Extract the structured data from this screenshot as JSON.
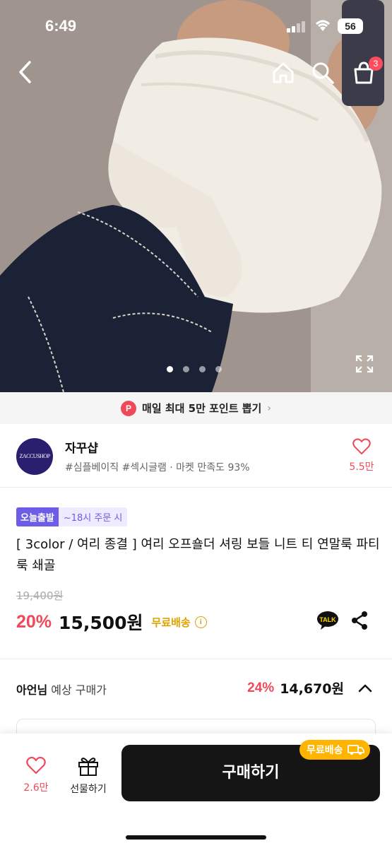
{
  "status_bar": {
    "time": "6:49",
    "battery": "56"
  },
  "header": {
    "back_icon": "chevron-left-icon",
    "home_icon": "home-icon",
    "search_icon": "search-icon",
    "cart_icon": "shopping-bag-icon",
    "cart_count": "3"
  },
  "gallery": {
    "total_images": 4,
    "active_index": 0
  },
  "point_banner": {
    "badge": "P",
    "text": "매일 최대 5만 포인트 뽑기"
  },
  "shop": {
    "logo_text": "ZACCUSHOP",
    "name": "자꾸샵",
    "tags": "#심플베이직 #섹시글램 · 마켓 만족도 93%",
    "like_count": "5.5만"
  },
  "product": {
    "badge_today": "오늘출발",
    "badge_time": "~18시 주문 시",
    "title": "[ 3color / 여리 종결 ] 여리 오프숄더 셔링 보들 니트 티 연말룩 파티룩 쇄골",
    "original_price": "19,400원",
    "discount": "20%",
    "price": "15,500원",
    "free_shipping": "무료배송",
    "talk_label": "TALK"
  },
  "member_price": {
    "name": "아언님",
    "label": "예상 구매가",
    "discount": "24%",
    "price": "14,670원"
  },
  "bottom_bar": {
    "wish_count": "2.6만",
    "gift_label": "선물하기",
    "buy_label": "구매하기",
    "free_tag": "무료배송"
  },
  "colors": {
    "accent_red": "#ef4a5a",
    "accent_purple": "#6c5ce7",
    "accent_yellow": "#e0a200",
    "free_tag": "#ffb400"
  }
}
